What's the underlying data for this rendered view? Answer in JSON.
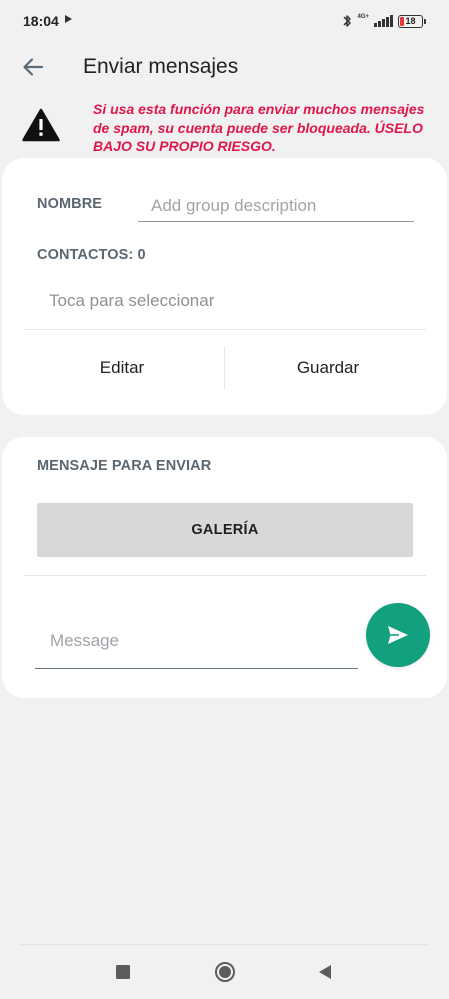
{
  "status_bar": {
    "time": "18:04",
    "network": "4G+",
    "battery": "18",
    "battery_color": "#e5383b"
  },
  "app_bar": {
    "back_icon": "arrow-left-icon",
    "title": "Enviar mensajes"
  },
  "warning": {
    "icon": "warning-triangle-icon",
    "text": "Si usa esta función para enviar muchos mensajes de spam, su cuenta puede ser bloqueada. ÚSELO BAJO SU PROPIO RIESGO.",
    "color": "#e0174b"
  },
  "group_card": {
    "name_label": "NOMBRE",
    "name_value": "",
    "name_placeholder": "Add group description",
    "contacts_label": "CONTACTOS: 0",
    "contacts_select_text": "Toca para seleccionar",
    "edit_label": "Editar",
    "save_label": "Guardar"
  },
  "message_card": {
    "label": "MENSAJE PARA ENVIAR",
    "gallery_label": "GALERÍA",
    "message_value": "",
    "message_placeholder": "Message",
    "send_icon": "send-icon",
    "send_color": "#12a07f"
  },
  "nav_bar": {
    "recent_icon": "square-icon",
    "home_icon": "circle-icon",
    "back_icon": "triangle-back-icon"
  }
}
